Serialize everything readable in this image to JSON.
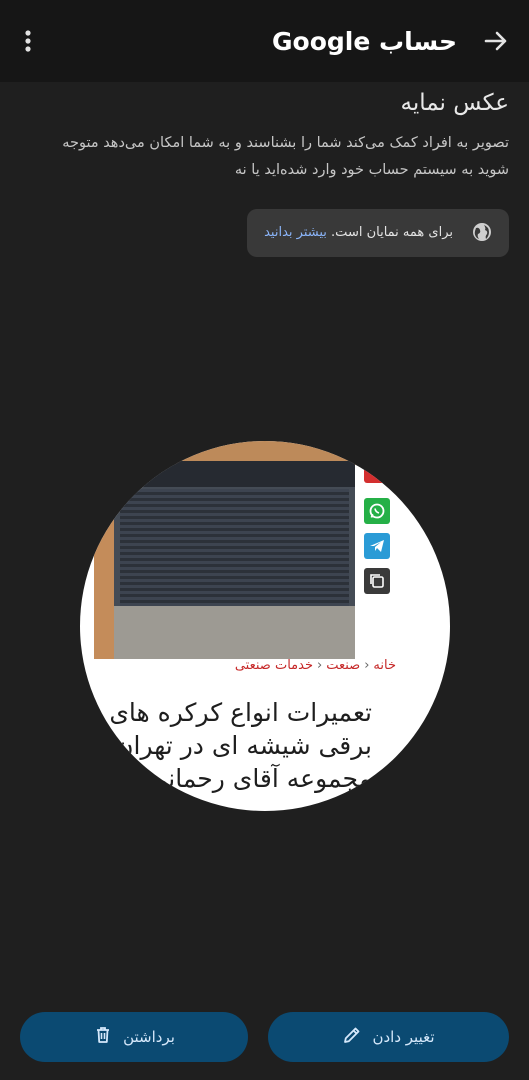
{
  "header": {
    "title": "حساب Google",
    "back_icon": "arrow-forward-icon",
    "menu_icon": "more-vert-icon"
  },
  "profile_photo": {
    "title": "عکس نمایه",
    "description": "تصویر به افراد کمک می‌کند شما را بشناسند و به شما امکان می‌دهد متوجه شوید به سیستم حساب خود وارد شده‌اید یا نه",
    "visibility_text": "برای همه نمایان است.",
    "learn_more": "بیشتر بدانید",
    "visibility_icon": "globe-icon"
  },
  "avatar_content": {
    "breadcrumb": [
      "خانه",
      "صنعت",
      "خدمات صنعتی"
    ],
    "headline_lines": [
      "تعمیرات انواع کرکره های",
      "برقی شیشه ای در تهران ا",
      "مجموعه آقای رحمانی"
    ],
    "share_icons": [
      "whatsapp-icon",
      "telegram-icon",
      "copy-icon"
    ]
  },
  "actions": {
    "change_label": "تغییر دادن",
    "remove_label": "برداشتن"
  },
  "colors": {
    "background": "#1f1f1f",
    "button": "#0b4a72",
    "link": "#8ab4f8"
  }
}
